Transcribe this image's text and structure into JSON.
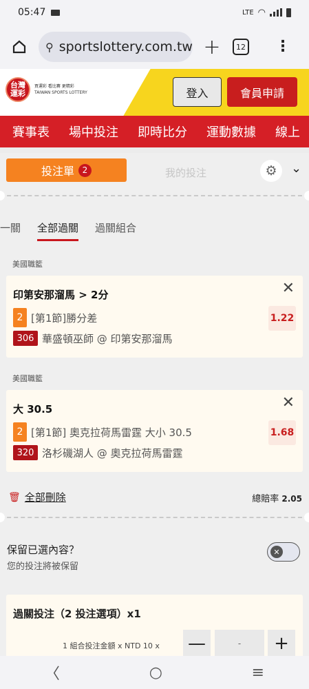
{
  "status": {
    "time": "05:47",
    "network": "LTE"
  },
  "browser": {
    "url": "sportslottery.com.tw/s",
    "tab_count": "12"
  },
  "header": {
    "logo_line1": "台灣",
    "logo_line2": "運彩",
    "tagline": "買運彩 看比賽 更精彩",
    "brand_en": "TAIWAN SPORTS LOTTERY",
    "login": "登入",
    "register": "會員申請"
  },
  "nav": [
    "賽事表",
    "場中投注",
    "即時比分",
    "運動數據",
    "線上"
  ],
  "slip": {
    "tab_slip": "投注單",
    "slip_count": "2",
    "tab_mine": "我的投注",
    "subtabs": [
      "一關",
      "全部過關",
      "過關組合"
    ],
    "bets": [
      {
        "league": "美國職籃",
        "title": "印第安那溜馬 > 2分",
        "period_num": "2",
        "market": "[第1節]勝分差",
        "game_no": "306",
        "match": "華盛頓巫師 @ 印第安那溜馬",
        "odds": "1.22"
      },
      {
        "league": "美國職籃",
        "title": "大 30.5",
        "period_num": "2",
        "market": "[第1節] 奧克拉荷馬雷霆 大小 30.5",
        "game_no": "320",
        "match": "洛杉磯湖人 @ 奧克拉荷馬雷霆",
        "odds": "1.68"
      }
    ],
    "delete_all": "全部刪除",
    "total_label": "總賠率",
    "total_odds": "2.05",
    "keep_question": "保留已選內容？",
    "keep_sub": "您的投注將被保留",
    "parlay_title": "過關投注（2 投注選項）x1",
    "amount_label": "1 組合投注金額 x NTD 10 x",
    "minus": "—",
    "stake": "-",
    "plus": "+"
  },
  "icons": {
    "home": "home-icon",
    "tune": "site-info-icon",
    "gear": "gear-icon",
    "chevron": "chevron-down-icon",
    "trash": "trash-icon",
    "close": "close-icon"
  },
  "colors": {
    "brand_red": "#d51f26",
    "accent_orange": "#f58220",
    "odds_red": "#c81e1e"
  }
}
